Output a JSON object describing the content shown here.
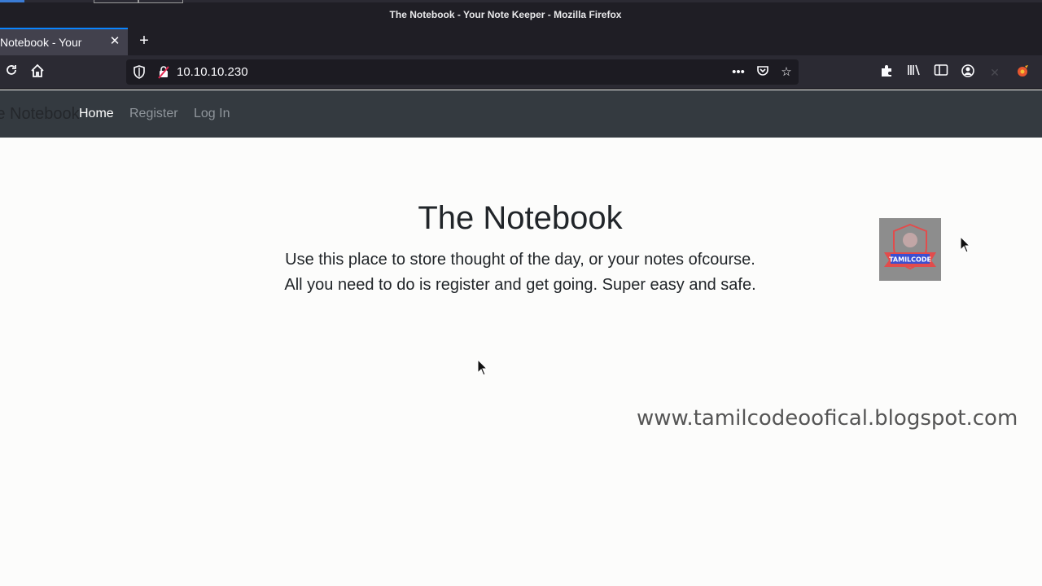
{
  "window": {
    "title": "The Notebook - Your Note Keeper - Mozilla Firefox"
  },
  "tabs": [
    {
      "label": "The Notebook - Your Note Keeper"
    }
  ],
  "address_bar": {
    "url": "10.10.10.230"
  },
  "site_nav": {
    "brand": "The Notebook",
    "links": [
      {
        "label": "Home"
      },
      {
        "label": "Register"
      },
      {
        "label": "Log In"
      }
    ]
  },
  "hero": {
    "title": "The Notebook",
    "line1": "Use this place to store thought of the day, or your notes ofcourse.",
    "line2": "All you need to do is register and get going. Super easy and safe."
  },
  "overlay": {
    "badge_text": "TAMILCODE",
    "watermark": "www.tamilcodeoofical.blogspot.com"
  },
  "colors": {
    "accent": "#0a84ff",
    "page_bg": "#fcfcfb",
    "navbar_bg": "#343a40"
  }
}
